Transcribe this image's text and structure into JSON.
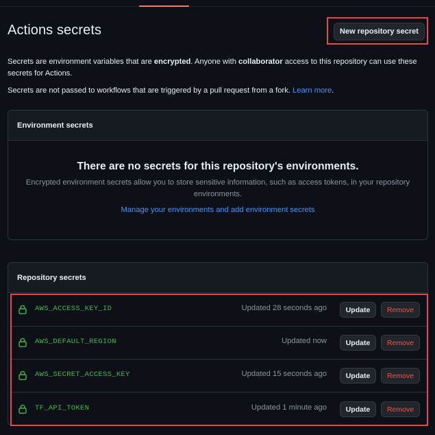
{
  "page": {
    "title": "Actions secrets",
    "new_secret_button": "New repository secret"
  },
  "description": {
    "p1_part1": "Secrets are environment variables that are ",
    "p1_bold1": "encrypted",
    "p1_part2": ". Anyone with ",
    "p1_bold2": "collaborator",
    "p1_part3": " access to this repository can use these secrets for Actions.",
    "p2_text": "Secrets are not passed to workflows that are triggered by a pull request from a fork. ",
    "p2_link": "Learn more",
    "p2_end": "."
  },
  "environment_secrets": {
    "header": "Environment secrets",
    "blank_title": "There are no secrets for this repository's environments.",
    "blank_description": "Encrypted environment secrets allow you to store sensitive information, such as access tokens, in your repository environments.",
    "manage_link": "Manage your environments and add environment secrets"
  },
  "repository_secrets": {
    "header": "Repository secrets",
    "update_label": "Update",
    "remove_label": "Remove",
    "lock_icon": "lock-icon",
    "items": [
      {
        "name": "AWS_ACCESS_KEY_ID",
        "updated": "Updated 28 seconds ago"
      },
      {
        "name": "AWS_DEFAULT_REGION",
        "updated": "Updated now"
      },
      {
        "name": "AWS_SECRET_ACCESS_KEY",
        "updated": "Updated 15 seconds ago"
      },
      {
        "name": "TF_API_TOKEN",
        "updated": "Updated 1 minute ago"
      }
    ]
  },
  "colors": {
    "background": "#0d1117",
    "header_bg": "#161b22",
    "border": "#30363d",
    "link": "#4493f8",
    "secret_name": "#3fb950",
    "danger": "#f85149",
    "highlight": "#e5484d",
    "active_tab": "#f78166"
  }
}
